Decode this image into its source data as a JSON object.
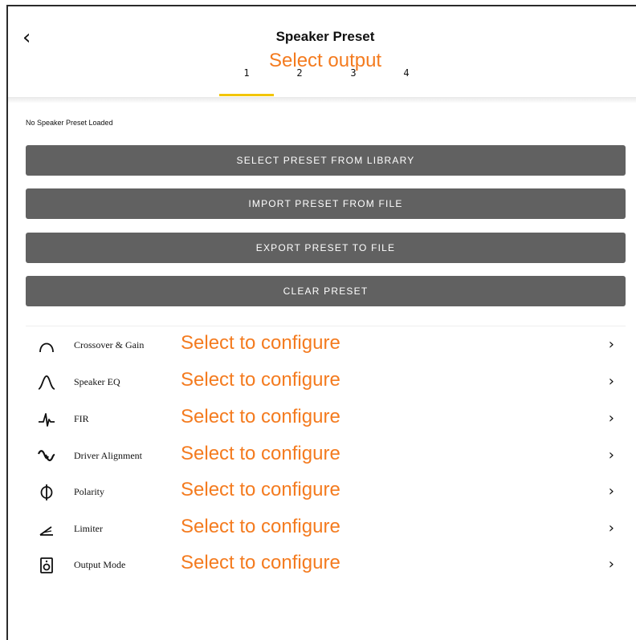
{
  "header": {
    "back_glyph": "‹",
    "title": "Speaker Preset",
    "annotation": "Select output",
    "tabs": [
      {
        "label": "1"
      },
      {
        "label": "2"
      },
      {
        "label": "3"
      },
      {
        "label": "4"
      }
    ],
    "active_tab": "1",
    "indicator_color": "#f2c500"
  },
  "status": "No Speaker Preset Loaded",
  "actions": [
    {
      "label": "SELECT PRESET FROM LIBRARY"
    },
    {
      "label": "IMPORT PRESET FROM FILE"
    },
    {
      "label": "EXPORT PRESET TO FILE"
    },
    {
      "label": "CLEAR PRESET"
    }
  ],
  "menu": [
    {
      "label": "Crossover & Gain",
      "icon": "crossover-icon",
      "annotation": "Select to configure"
    },
    {
      "label": "Speaker EQ",
      "icon": "eq-curve-icon",
      "annotation": "Select to configure"
    },
    {
      "label": "FIR",
      "icon": "fir-impulse-icon",
      "annotation": "Select to configure"
    },
    {
      "label": "Driver Alignment",
      "icon": "alignment-wave-icon",
      "annotation": "Select to configure"
    },
    {
      "label": "Polarity",
      "icon": "phi-polarity-icon",
      "annotation": "Select to configure"
    },
    {
      "label": "Limiter",
      "icon": "limiter-icon",
      "annotation": "Select to configure"
    },
    {
      "label": "Output Mode",
      "icon": "speaker-icon",
      "annotation": "Select to configure"
    }
  ],
  "chevron_glyph": "›",
  "colors": {
    "annotation": "#f47b1f",
    "button_bg": "#616161",
    "button_text": "#ffffff"
  }
}
